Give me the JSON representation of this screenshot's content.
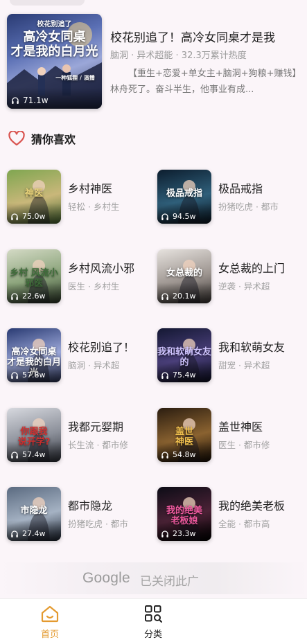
{
  "featured": {
    "title": "校花别追了！高冷女同桌才是我",
    "meta": "脑洞 · 异术超能 · 32.3万累计热度",
    "description": "【重生+恋爱+单女主+脑洞+狗粮+赚钱】林舟死了。奋斗半生，他事业有成...",
    "plays": "71.1w",
    "cover_text": {
      "top": "校花别追了",
      "main": "高冷女同桌\n才是我的白月光",
      "author": "一种狐狸 / 演播"
    }
  },
  "section": {
    "title": "猜你喜欢"
  },
  "books": [
    {
      "name": "乡村神医",
      "tags": "轻松 · 乡村生",
      "plays": "75.0w",
      "cover_text": "神医"
    },
    {
      "name": "极品戒指",
      "tags": "扮猪吃虎 · 都市",
      "plays": "94.5w",
      "cover_text": "极品戒指"
    },
    {
      "name": "乡村风流小邪",
      "tags": "医生 · 乡村生",
      "plays": "22.6w",
      "cover_text": "乡村 风流小邪医"
    },
    {
      "name": "女总裁的上门",
      "tags": "逆袭 · 异术超",
      "plays": "20.1w",
      "cover_text": "女总裁的"
    },
    {
      "name": "校花别追了！",
      "tags": "脑洞 · 异术超",
      "plays": "57.8w",
      "cover_text": "高冷女同桌\n才是我的白月光"
    },
    {
      "name": "我和软萌女友",
      "tags": "甜宠 · 异术超",
      "plays": "75.4w",
      "cover_text": "我和软萌女友的"
    },
    {
      "name": "我都元婴期",
      "tags": "长生流 · 都市修",
      "plays": "57.4w",
      "cover_text": "你跟我\n说开学?"
    },
    {
      "name": "盖世神医",
      "tags": "医生 · 都市修",
      "plays": "54.8w",
      "cover_text": "盖世\n神医"
    },
    {
      "name": "都市隐龙",
      "tags": "扮猪吃虎 · 都市",
      "plays": "27.4w",
      "cover_text": "市隐龙"
    },
    {
      "name": "我的绝美老板",
      "tags": "全能 · 都市高",
      "plays": "23.3w",
      "cover_text": "我的绝美\n老板娘"
    }
  ],
  "ad": {
    "logo": "Google",
    "message": "已关闭此广"
  },
  "nav": [
    {
      "label": "首页",
      "icon": "home-icon",
      "active": true
    },
    {
      "label": "分类",
      "icon": "category-search-icon",
      "active": false
    }
  ],
  "colors": {
    "accent": "#e49a2f",
    "heart": "#d9534f",
    "muted": "#9a9a9a"
  }
}
